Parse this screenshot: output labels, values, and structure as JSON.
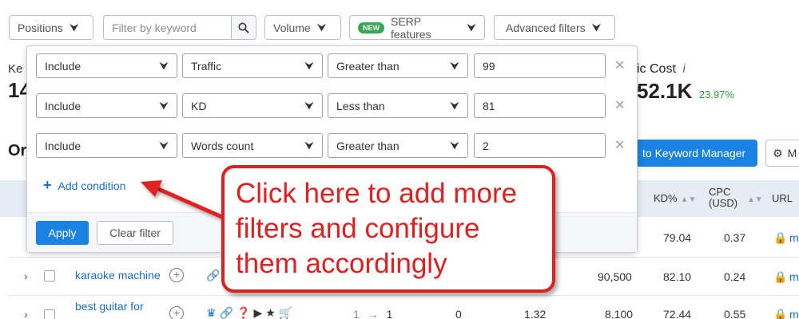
{
  "toolbar": {
    "positions_label": "Positions",
    "keyword_placeholder": "Filter by keyword",
    "volume_label": "Volume",
    "serp_badge": "NEW",
    "serp_label": "SERP features",
    "advanced_label": "Advanced filters"
  },
  "background": {
    "ke_fragment": "Ke",
    "big_fragment": "14",
    "cost_label": "ic Cost",
    "cost_info": "i",
    "cost_value": "52.1K",
    "cost_change": "23.97%",
    "or_fragment": "Or",
    "kw_manager_label": "to Keyword Manager",
    "more_label": "M",
    "columns": {
      "kd": "KD%",
      "cpc_line1": "CPC",
      "cpc_line2": "(USD)",
      "url": "URL"
    },
    "rows": [
      {
        "keyword": "",
        "kd": "79.04",
        "cpc": "0.37",
        "url": "m"
      },
      {
        "keyword": "karaoke machine",
        "volume": "90,500",
        "kd": "82.10",
        "cpc": "0.24",
        "url": "m"
      },
      {
        "keyword": "best guitar for",
        "pos_from": "1",
        "pos_to": "1",
        "diff": "0",
        "cell_a": "1.32",
        "volume": "8,100",
        "kd": "72.44",
        "cpc": "0.55",
        "url": "m"
      }
    ]
  },
  "filters": {
    "conditions": [
      {
        "mode": "Include",
        "field": "Traffic",
        "operator": "Greater than",
        "value": "99"
      },
      {
        "mode": "Include",
        "field": "KD",
        "operator": "Less than",
        "value": "81"
      },
      {
        "mode": "Include",
        "field": "Words count",
        "operator": "Greater than",
        "value": "2"
      }
    ],
    "add_condition_label": "Add condition",
    "apply_label": "Apply",
    "clear_label": "Clear filter"
  },
  "callout": {
    "line1": "Click here to add more",
    "line2": "filters and configure",
    "line3": "them accordingly"
  },
  "colors": {
    "accent": "#1a82e2",
    "callout_red": "#e02020",
    "positive": "#2d9d3a"
  }
}
